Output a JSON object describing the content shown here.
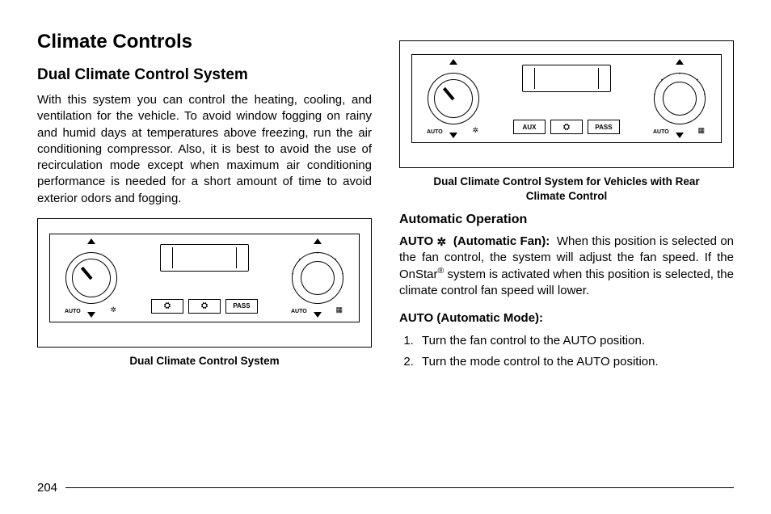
{
  "left": {
    "h1": "Climate Controls",
    "h2": "Dual Climate Control System",
    "para1": "With this system you can control the heating, cooling, and ventilation for the vehicle. To avoid window fogging on rainy and humid days at temperatures above freezing, run the air conditioning compressor. Also, it is best to avoid the use of recirculation mode except when maximum air conditioning performance is needed for a short amount of time to avoid exterior odors and fogging.",
    "caption1": "Dual Climate Control System"
  },
  "right": {
    "caption2a": "Dual Climate Control System for Vehicles with Rear",
    "caption2b": "Climate Control",
    "h3a": "Automatic Operation",
    "auto_label": "AUTO",
    "auto_fan_suffix": "(Automatic Fan):",
    "para2_pre": "When this position is selected on the fan control, the system will adjust the fan speed. If the OnStar",
    "para2_post": " system is activated when this position is selected, the climate control fan speed will lower.",
    "h3b": "AUTO (Automatic Mode):",
    "steps": [
      "Turn the fan control to the AUTO position.",
      "Turn the mode control to the AUTO position."
    ]
  },
  "panel": {
    "auto": "AUTO",
    "aux": "AUX",
    "pass": "PASS"
  },
  "page": "204"
}
